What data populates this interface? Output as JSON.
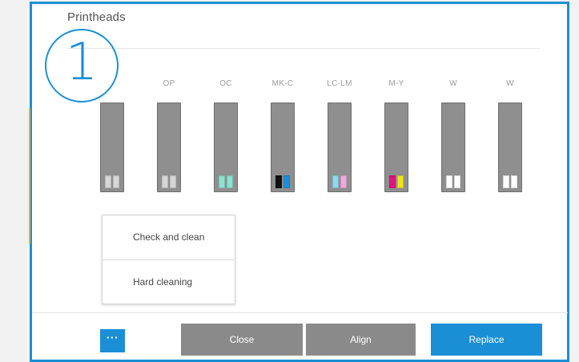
{
  "dialog": {
    "title": "Printheads",
    "step_number": "1"
  },
  "printheads": [
    {
      "label": "",
      "swatch": [
        "#d6d6d6",
        "#d6d6d6"
      ]
    },
    {
      "label": "OP",
      "swatch": [
        "#d6d6d6",
        "#d6d6d6"
      ]
    },
    {
      "label": "OC",
      "swatch": [
        "#8fe0cf",
        "#8fe0cf"
      ]
    },
    {
      "label": "MK-C",
      "swatch": [
        "#111111",
        "#1c8fd8"
      ]
    },
    {
      "label": "LC-LM",
      "swatch": [
        "#8fd8ef",
        "#f2a8dc"
      ]
    },
    {
      "label": "M-Y",
      "swatch": [
        "#e0157d",
        "#f5e11b"
      ]
    },
    {
      "label": "W",
      "swatch": [
        "#ffffff",
        "#ffffff"
      ]
    },
    {
      "label": "W",
      "swatch": [
        "#ffffff",
        "#ffffff"
      ]
    }
  ],
  "menu": {
    "items": [
      "Check and clean",
      "Hard cleaning"
    ]
  },
  "buttons": {
    "more": "···",
    "close": "Close",
    "align": "Align",
    "replace": "Replace"
  },
  "colors": {
    "accent": "#1a8fd6",
    "button_gray": "#8a8a8a",
    "printhead_body": "#8f8f8f"
  }
}
